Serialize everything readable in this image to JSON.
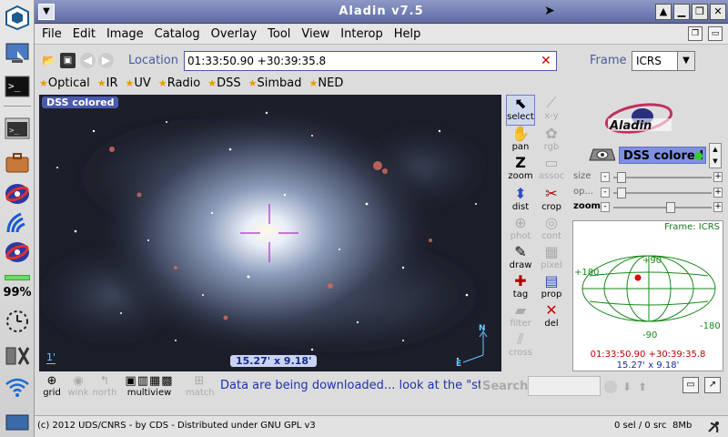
{
  "window": {
    "title": "Aladin v7.5"
  },
  "menu": [
    "File",
    "Edit",
    "Image",
    "Catalog",
    "Overlay",
    "Tool",
    "View",
    "Interop",
    "Help"
  ],
  "location": {
    "label": "Location",
    "value": "01:33:50.90 +30:39:35.8"
  },
  "frame": {
    "label": "Frame",
    "value": "ICRS"
  },
  "bands": [
    "Optical",
    "IR",
    "UV",
    "Radio",
    "DSS",
    "Simbad",
    "NED"
  ],
  "view": {
    "layer_label": "DSS colored",
    "scale_label": "1'",
    "size_label": "15.27' x 9.18'",
    "north": "N",
    "east": "E"
  },
  "tools": [
    {
      "label": "select",
      "icon": "cursor-icon",
      "enabled": true
    },
    {
      "label": "x-y",
      "icon": "xy-plot-icon",
      "enabled": false
    },
    {
      "label": "pan",
      "icon": "hand-icon",
      "enabled": true
    },
    {
      "label": "rgb",
      "icon": "rgb-icon",
      "enabled": false
    },
    {
      "label": "zoom",
      "icon": "zoom-icon",
      "enabled": true
    },
    {
      "label": "assoc",
      "icon": "assoc-icon",
      "enabled": false
    },
    {
      "label": "dist",
      "icon": "dist-icon",
      "enabled": true
    },
    {
      "label": "crop",
      "icon": "scissors-icon",
      "enabled": true
    },
    {
      "label": "phot",
      "icon": "phot-icon",
      "enabled": false
    },
    {
      "label": "cont",
      "icon": "contour-icon",
      "enabled": false
    },
    {
      "label": "draw",
      "icon": "pencil-icon",
      "enabled": true
    },
    {
      "label": "pixel",
      "icon": "pixel-icon",
      "enabled": false
    },
    {
      "label": "tag",
      "icon": "tag-icon",
      "enabled": true
    },
    {
      "label": "prop",
      "icon": "properties-icon",
      "enabled": true
    },
    {
      "label": "filter",
      "icon": "filter-icon",
      "enabled": false
    },
    {
      "label": "del",
      "icon": "delete-icon",
      "enabled": true
    },
    {
      "label": "cross",
      "icon": "cross-match-icon",
      "enabled": false
    }
  ],
  "layer": {
    "name": "DSS colored"
  },
  "sliders": {
    "size": "size",
    "opacity": "op...",
    "zoom": "zoom"
  },
  "frame_panel": {
    "title": "Frame: ICRS",
    "lat_top": "+90",
    "lat_bottom": "-90",
    "lon_left": "+180",
    "lon_right": "-180",
    "coord": "01:33:50.90 +30:39:35.8",
    "size": "15.27' x 9.18'"
  },
  "bottom_tools": [
    {
      "label": "grid",
      "icon": "grid-icon",
      "enabled": true
    },
    {
      "label": "wink",
      "icon": "eye-icon",
      "enabled": false
    },
    {
      "label": "north",
      "icon": "north-icon",
      "enabled": false
    },
    {
      "label": "multiview",
      "icon": "multiview-icon",
      "enabled": true
    },
    {
      "label": "match",
      "icon": "match-icon",
      "enabled": false
    }
  ],
  "status_message": "Data are being downloaded... look at the \"status\"",
  "search": {
    "label": "Search",
    "value": ""
  },
  "taskbar": {
    "battery": "99%"
  },
  "statusbar": {
    "copyright": "(c) 2012 UDS/CNRS - by CDS - Distributed under GNU GPL v3",
    "selection": "0 sel / 0 src",
    "memory": "8Mb"
  },
  "colors": {
    "title_bar": "#5e6aa6",
    "accent": "#4a5aa0",
    "reticle": "#b030c0",
    "coord_red": "#c00000",
    "coord_blue": "#1a2a9a",
    "grid_green": "#1a8a1a"
  }
}
